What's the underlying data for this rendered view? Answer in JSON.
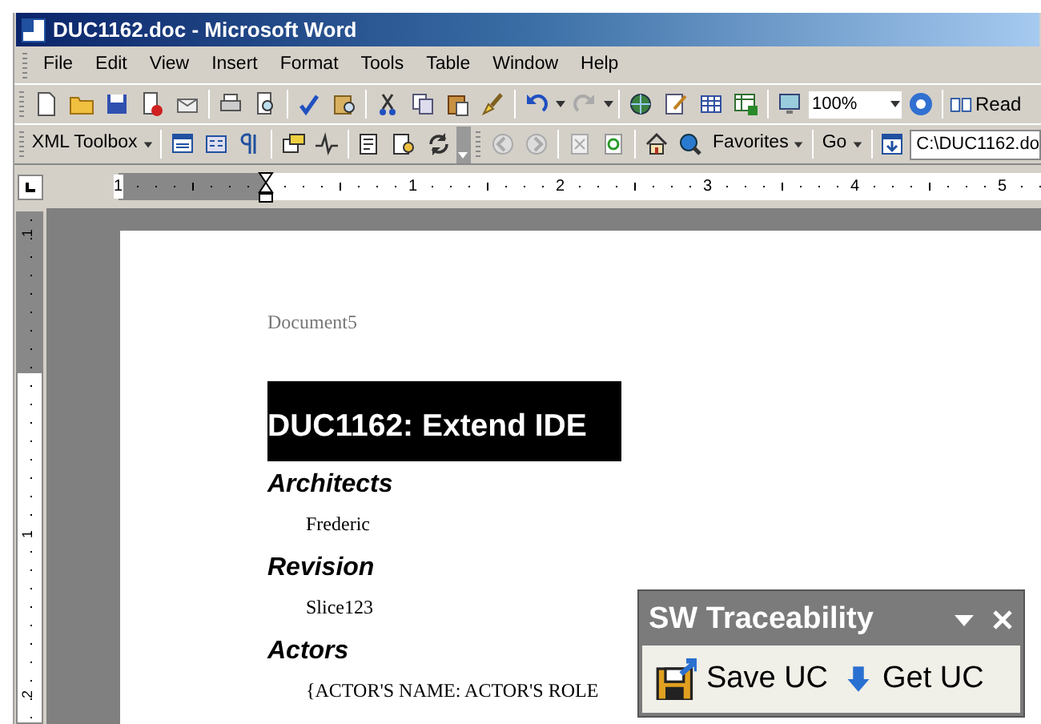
{
  "window": {
    "title": "DUC1162.doc - Microsoft Word"
  },
  "menu": [
    "File",
    "Edit",
    "View",
    "Insert",
    "Format",
    "Tools",
    "Table",
    "Window",
    "Help"
  ],
  "standard_toolbar": {
    "zoom": "100%",
    "read_button": "Read"
  },
  "xml_toolbar": {
    "xml_toolbox": "XML Toolbox",
    "favorites": "Favorites",
    "go": "Go",
    "address": "C:\\DUC1162.do"
  },
  "ruler": {
    "horizontal_numbers": [
      "1",
      "1",
      "2",
      "3",
      "4",
      "5"
    ],
    "vertical_numbers": [
      "1",
      "1",
      "2"
    ]
  },
  "document": {
    "header": "Document5",
    "title": "DUC1162: Extend IDE",
    "sections": [
      {
        "heading": "Architects",
        "body": "Frederic"
      },
      {
        "heading": "Revision",
        "body": "Slice123"
      },
      {
        "heading": "Actors",
        "body": "{ACTOR'S NAME: ACTOR'S ROLE"
      }
    ]
  },
  "panel": {
    "title": "SW Traceability",
    "buttons": [
      "Save UC",
      "Get UC"
    ]
  }
}
